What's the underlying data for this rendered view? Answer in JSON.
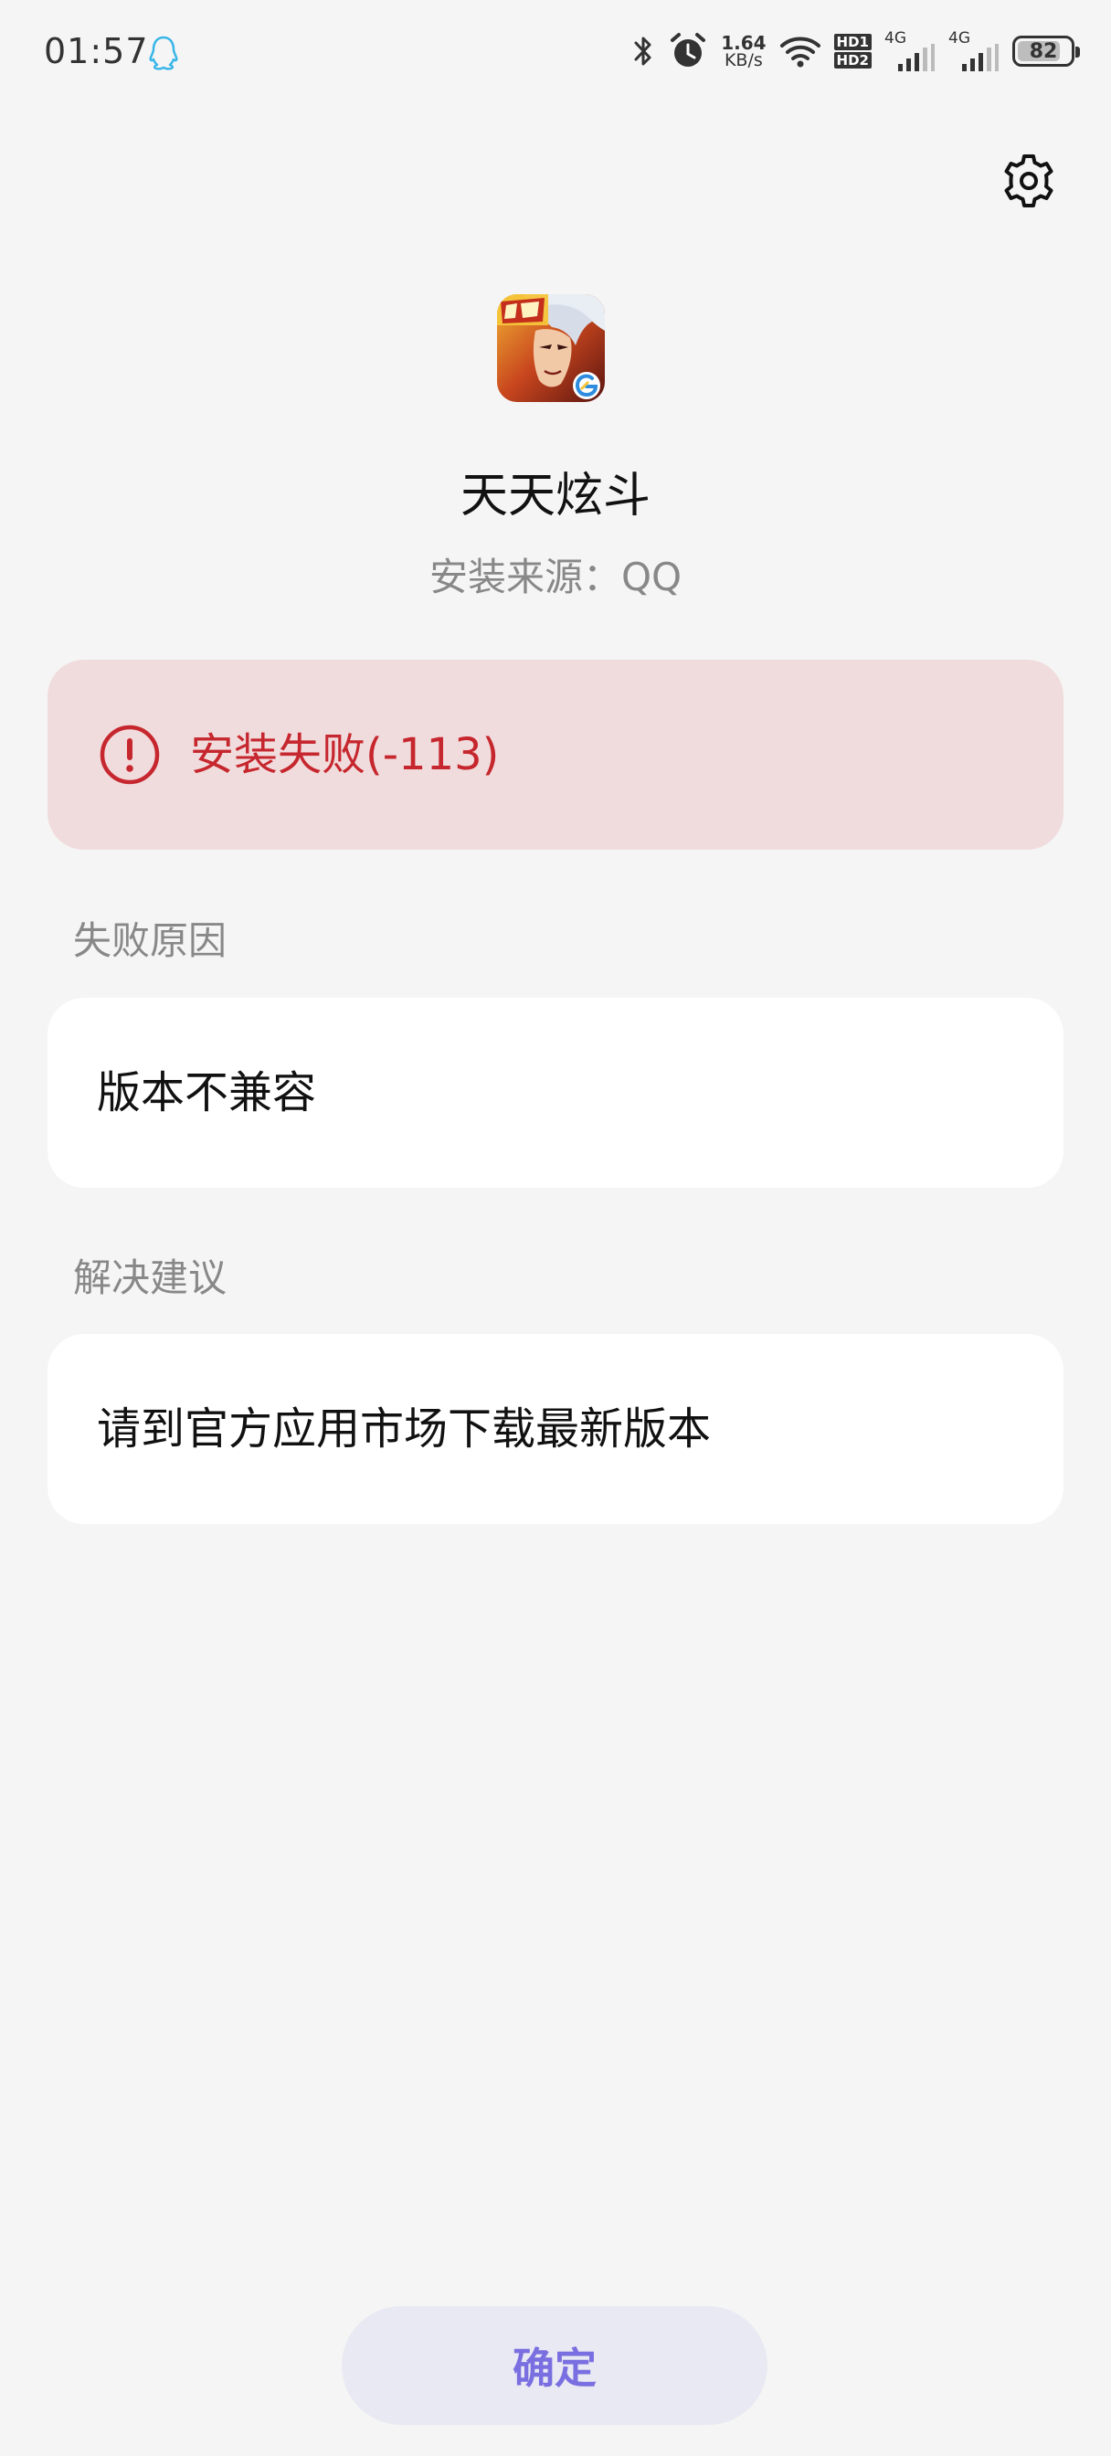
{
  "status_bar": {
    "time": "01:57",
    "net_speed_value": "1.64",
    "net_speed_unit": "KB/s",
    "hd1": "HD1",
    "hd2": "HD2",
    "sim1_label": "4G",
    "sim2_label": "4G",
    "battery_level": "82",
    "battery_fraction": 0.82
  },
  "app": {
    "name": "天天炫斗",
    "install_source": "安装来源：QQ",
    "icon": "game-icon"
  },
  "error": {
    "message": "安装失败(-113)",
    "color": "#c6272e",
    "background": "#f1dcdd"
  },
  "failure_reason": {
    "label": "失败原因",
    "text": "版本不兼容"
  },
  "suggestion": {
    "label": "解决建议",
    "text": "请到官方应用市场下载最新版本"
  },
  "confirm_button": {
    "label": "确定",
    "color": "#7a6fe0"
  }
}
